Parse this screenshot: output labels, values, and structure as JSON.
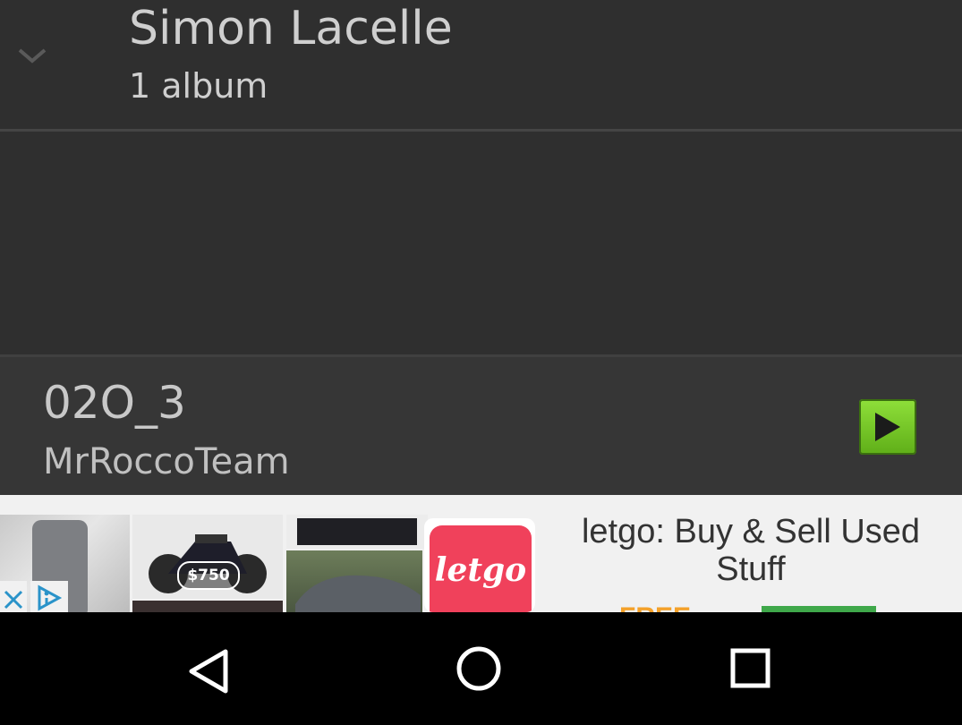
{
  "artist": {
    "name": "Simon Lacelle",
    "subtitle": "1 album",
    "expand_icon": "chevron-down-icon"
  },
  "now_playing": {
    "title": "02O_3",
    "artist": "MrRoccoTeam",
    "play_icon": "play-icon",
    "accent": "#7ccf2c"
  },
  "ad": {
    "price": "$750",
    "brand": "letgo",
    "headline": "letgo: Buy & Sell Used Stuff",
    "cta_free": "FREE",
    "close_icon": "close-icon",
    "adchoices_icon": "adchoices-icon"
  },
  "navbar": {
    "back_icon": "back-icon",
    "home_icon": "home-icon",
    "recents_icon": "recents-icon"
  }
}
